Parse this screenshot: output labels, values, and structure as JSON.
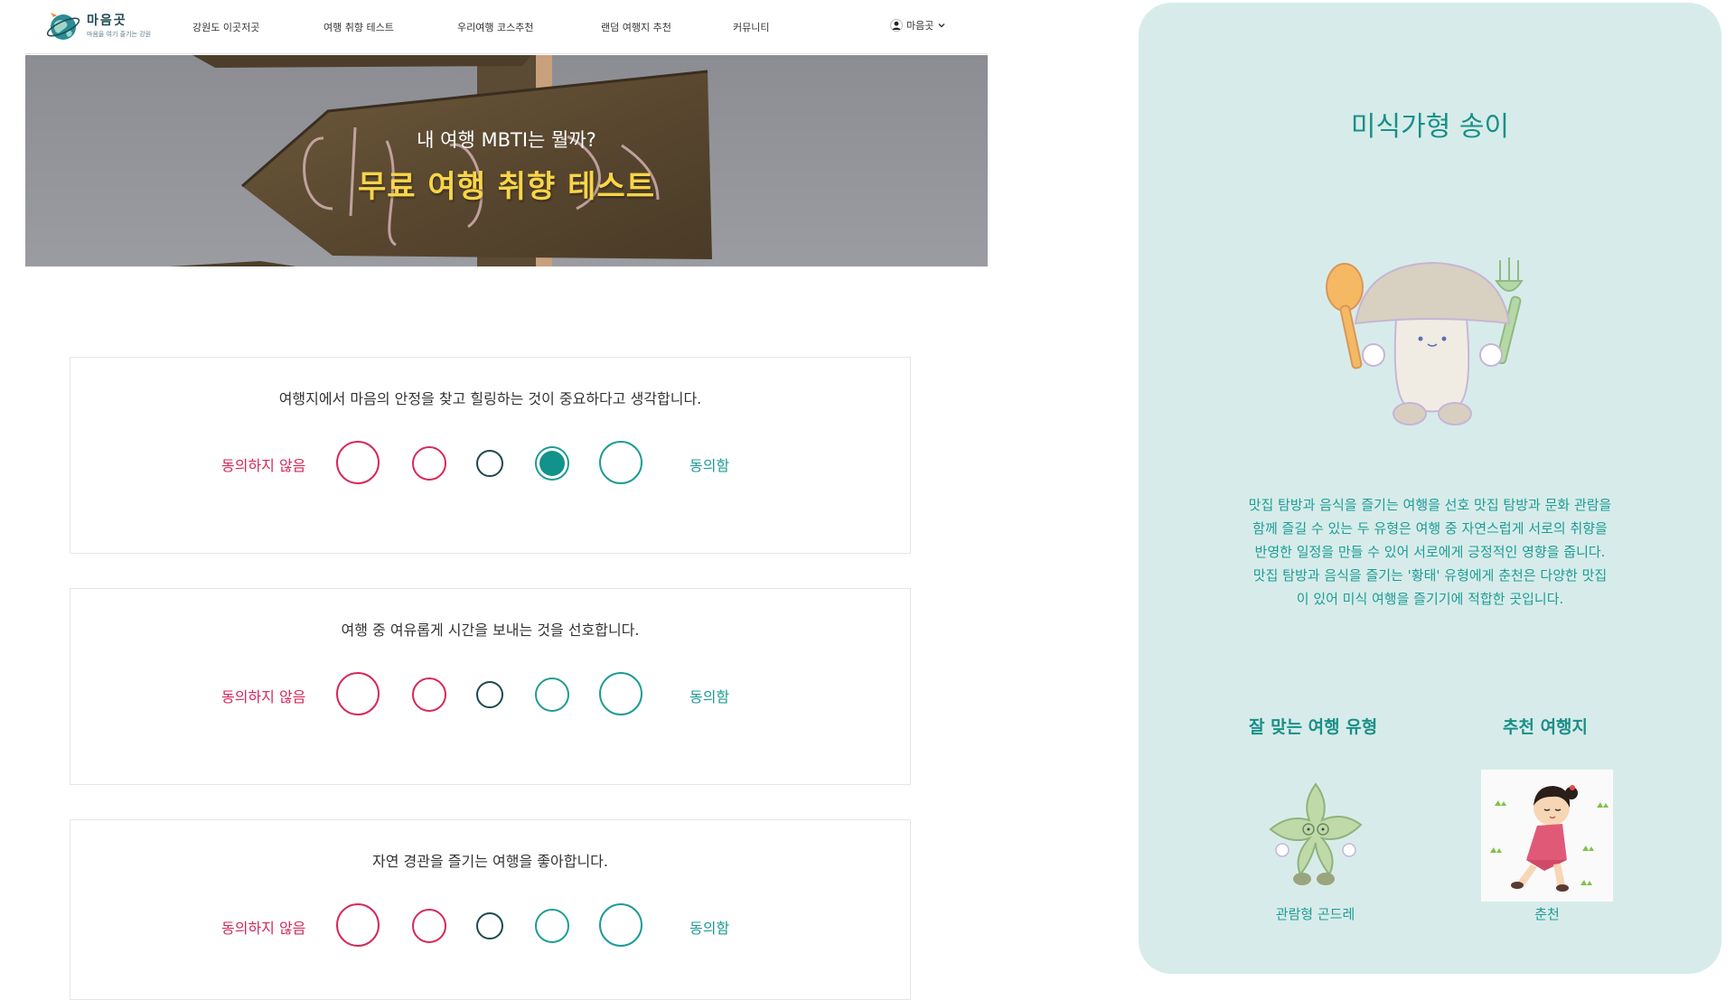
{
  "header": {
    "logo_title": "마음곳",
    "logo_sub": "마음을 여기 즐기는 강원",
    "nav": [
      "강원도 이곳저곳",
      "여행 취향 테스트",
      "우리여행 코스추천",
      "랜덤 여행지 추천",
      "커뮤니티"
    ],
    "user_label": "마음곳"
  },
  "banner": {
    "line1": "내 여행 MBTI는 뭘까?",
    "line2": "무료 여행 취향 테스트"
  },
  "questions": [
    {
      "text": "여행지에서 마음의 안정을 찾고 힐링하는 것이 중요하다고 생각합니다.",
      "selected": 4
    },
    {
      "text": "여행 중 여유롭게 시간을 보내는 것을 선호합니다.",
      "selected": 0
    },
    {
      "text": "자연 경관을 즐기는 여행을 좋아합니다.",
      "selected": 0
    }
  ],
  "scale": {
    "disagree": "동의하지 않음",
    "agree": "동의함"
  },
  "result": {
    "title": "미식가형 송이",
    "description": "맛집 탐방과 음식을 즐기는 여행을 선호 맛집 탐방과 문화 관람을 함께 즐길 수 있는 두 유형은 여행 중 자연스럽게 서로의 취향을 반영한 일정을 만들 수 있어 서로에게 긍정적인 영향을 줍니다. 맛집 탐방과 음식을 즐기는 '황태' 유형에게 춘천은 다양한 맛집이 있어 미식 여행을 즐기기에 적합한 곳입니다.",
    "match_title": "잘 맞는 여행 유형",
    "match_name": "관람형 곤드레",
    "dest_title": "추천 여행지",
    "dest_name": "춘천"
  },
  "colors": {
    "accent": "#1a8f88",
    "disagree": "#d6285a",
    "panel_bg": "#d7ecea",
    "banner_yellow": "#f8d548"
  },
  "icons": [
    "logo-globe-icon",
    "user-icon",
    "chevron-down-icon"
  ]
}
